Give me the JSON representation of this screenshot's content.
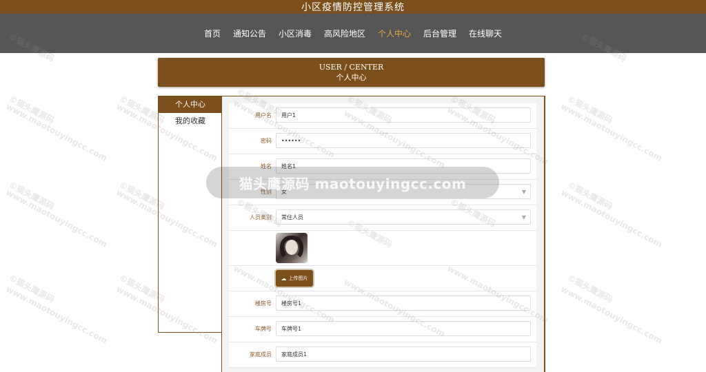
{
  "app": {
    "title": "小区疫情防控管理系统"
  },
  "nav": {
    "items": [
      {
        "label": "首页"
      },
      {
        "label": "通知公告"
      },
      {
        "label": "小区消毒"
      },
      {
        "label": "高风险地区"
      },
      {
        "label": "个人中心"
      },
      {
        "label": "后台管理"
      },
      {
        "label": "在线聊天"
      }
    ],
    "active": "个人中心",
    "active_color": "#e9a93f"
  },
  "header": {
    "en": "USER / CENTER",
    "cn": "个人中心"
  },
  "sidebar": {
    "items": [
      {
        "label": "个人中心"
      },
      {
        "label": "我的收藏"
      }
    ]
  },
  "form": {
    "username": {
      "label": "用户名",
      "value": "用户1"
    },
    "password": {
      "label": "密码",
      "value": "••••••"
    },
    "name": {
      "label": "姓名",
      "value": "姓名1"
    },
    "gender": {
      "label": "性别",
      "value": "女"
    },
    "person_type": {
      "label": "人员类别",
      "value": "常住人员"
    },
    "upload": {
      "label": "上传图片",
      "icon": "cloud-upload-icon"
    },
    "building": {
      "label": "楼房号",
      "value": "楼房号1"
    },
    "plate": {
      "label": "车牌号",
      "value": "车牌号1"
    },
    "family": {
      "label": "家庭成员",
      "value": "家庭成员1"
    }
  },
  "watermark": {
    "banner": "猫头鹰源码 maotouyingcc.com",
    "tile_cn": "©猫头鹰源码",
    "tile_en": "www.maotouyingcc.com"
  },
  "colors": {
    "brand": "#7a4f1c",
    "nav_bg": "#555555"
  }
}
